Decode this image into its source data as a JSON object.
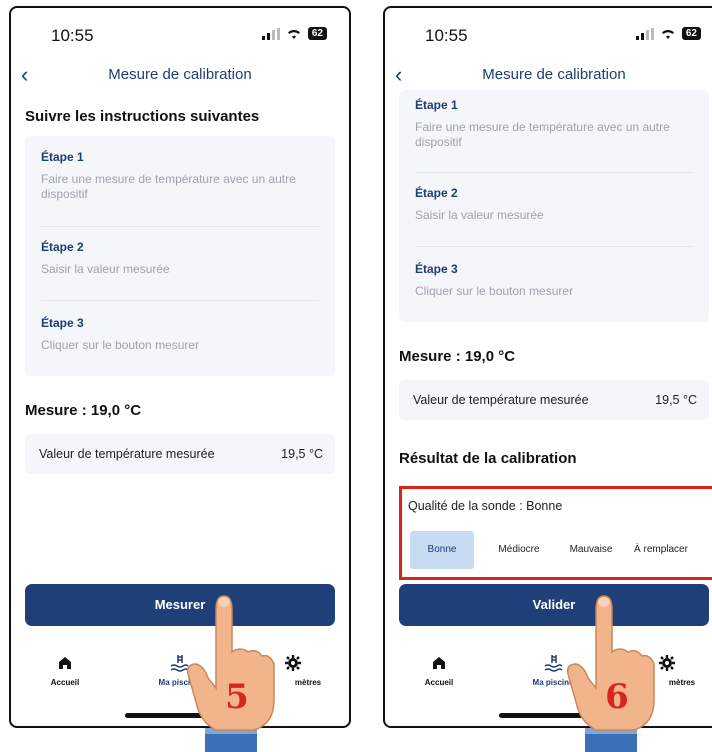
{
  "status": {
    "time": "10:55",
    "battery": "62"
  },
  "header": {
    "title": "Mesure de calibration",
    "back": "‹"
  },
  "instructions_title": "Suivre les instructions suivantes",
  "steps": [
    {
      "title": "Étape 1",
      "desc": "Faire une mesure de température avec un autre dispositif"
    },
    {
      "title": "Étape 2",
      "desc": "Saisir la valeur mesurée"
    },
    {
      "title": "Étape 3",
      "desc": "Cliquer sur le bouton mesurer"
    }
  ],
  "measure": {
    "title": "Mesure : 19,0 °C",
    "row_label": "Valeur de température mesurée",
    "row_value": "19,5 °C"
  },
  "left_button": "Mesurer",
  "right_button": "Valider",
  "calibration": {
    "title": "Résultat de la calibration",
    "quality_label": "Qualité de la sonde : Bonne",
    "options": [
      "Bonne",
      "Médiocre",
      "Mauvaise",
      "À remplacer"
    ],
    "selected": "Bonne"
  },
  "tabbar": {
    "home": "Accueil",
    "pool": "Ma piscine",
    "settings": "Paramètres",
    "settings_visible": "mètres"
  },
  "hands": {
    "left_number": "5",
    "right_number": "6"
  },
  "colors": {
    "accent": "#1e3f77",
    "highlight": "#d7261e",
    "selected_bg": "#c7dcf3",
    "hand_number": "#d7261e"
  }
}
